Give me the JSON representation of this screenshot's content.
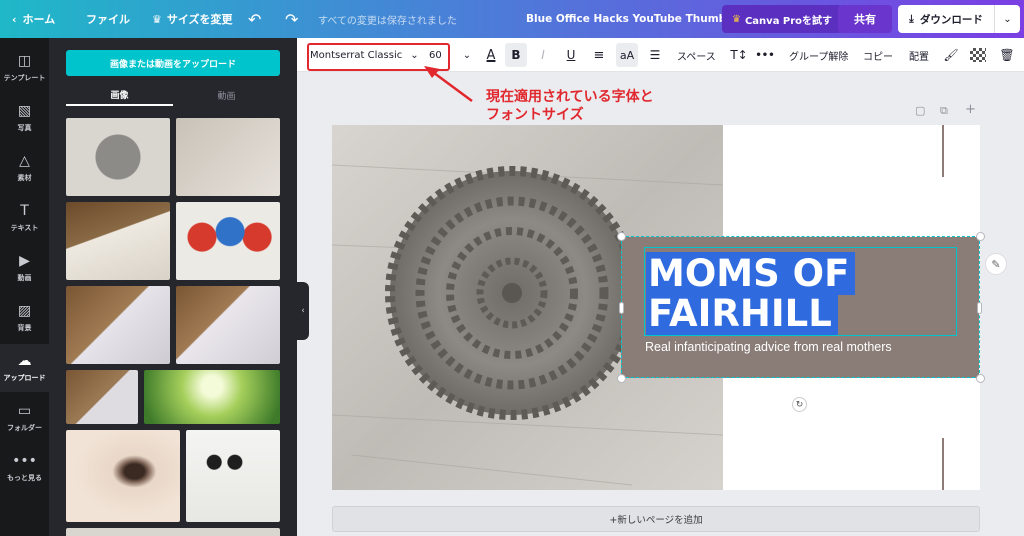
{
  "topbar": {
    "home": "ホーム",
    "file": "ファイル",
    "resize": "サイズを変更",
    "saved_status": "すべての変更は保存されました",
    "doc_title": "Blue Office Hacks YouTube Thumbnail",
    "pro_button": "Canva Proを試す",
    "share": "共有",
    "download": "ダウンロード"
  },
  "nav": [
    {
      "label": "テンプレート",
      "icon": "template-icon"
    },
    {
      "label": "写真",
      "icon": "photo-icon"
    },
    {
      "label": "素材",
      "icon": "elements-icon"
    },
    {
      "label": "テキスト",
      "icon": "text-icon"
    },
    {
      "label": "動画",
      "icon": "video-icon"
    },
    {
      "label": "背景",
      "icon": "background-icon"
    },
    {
      "label": "アップロード",
      "icon": "upload-icon"
    },
    {
      "label": "フォルダー",
      "icon": "folder-icon"
    },
    {
      "label": "もっと見る",
      "icon": "more-icon"
    }
  ],
  "panel": {
    "upload_button": "画像または動画をアップロード",
    "tab_images": "画像",
    "tab_videos": "動画"
  },
  "toolbar": {
    "font_name": "Montserrat Classic",
    "font_size": "60",
    "text_color_label": "A",
    "bold_label": "B",
    "italic_label": "I",
    "underline_label": "U",
    "case_label": "aA",
    "spacing": "スペース",
    "ungroup": "グループ解除",
    "copy": "コピー",
    "arrange": "配置"
  },
  "annotation": {
    "line1": "現在適用されている字体と",
    "line2": "フォントサイズ"
  },
  "design": {
    "headline_line1": "MOMS OF",
    "headline_line2": "FAIRHILL",
    "subtitle": "Real infanticipating advice from real mothers"
  },
  "add_page": "+新しいページを追加",
  "colors": {
    "accent": "#00c4cc",
    "textbox_bg": "#8a7d78",
    "highlight": "#2f6bdf",
    "annotation": "#e0282e"
  }
}
